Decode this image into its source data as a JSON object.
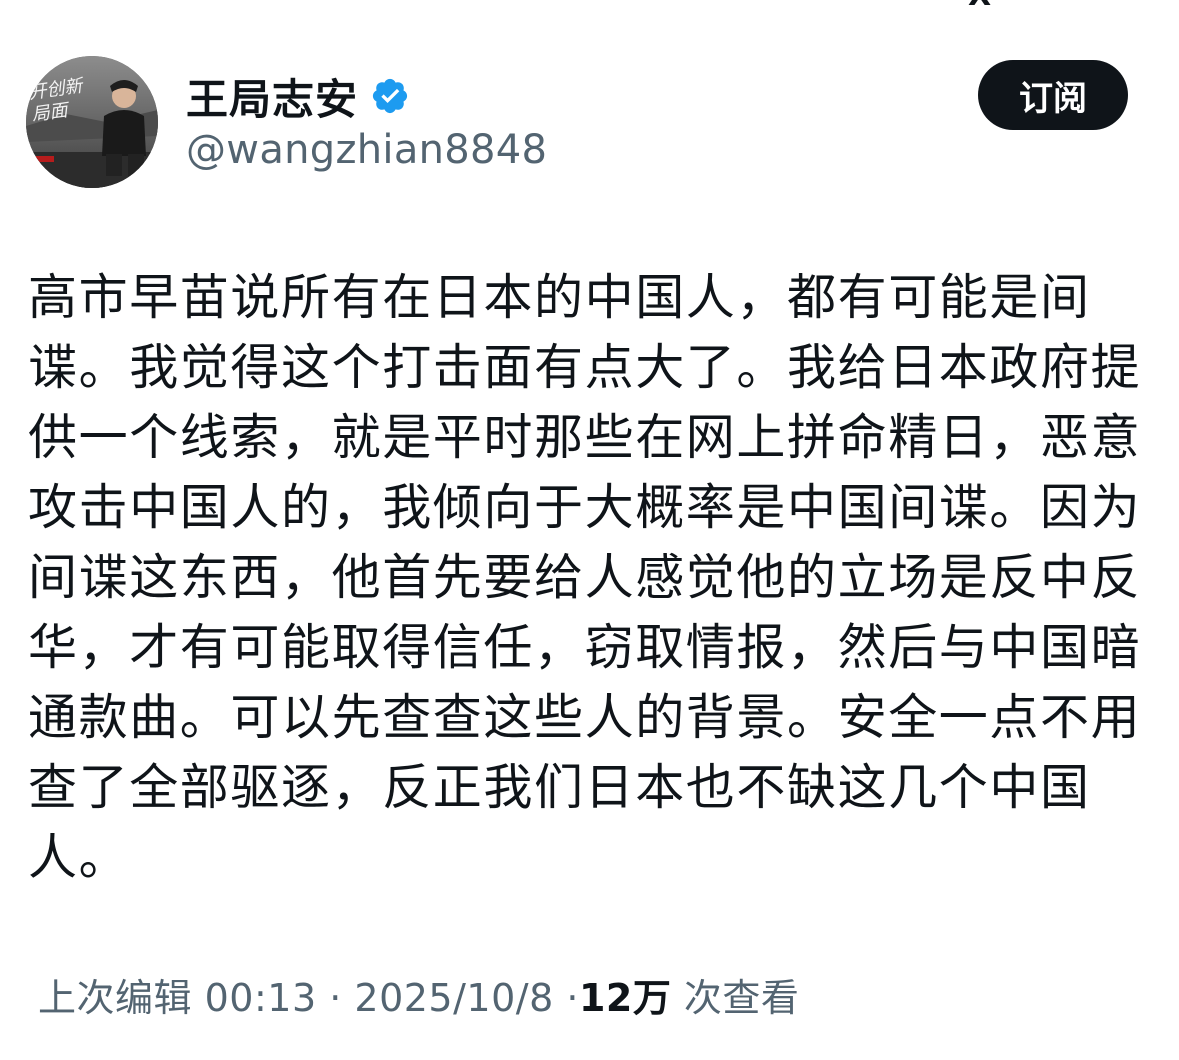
{
  "header": {
    "display_name": "王局志安",
    "handle": "@wangzhian8848",
    "subscribe_label": "订阅",
    "avatar_caption": "开创新局面",
    "logo_text": "X"
  },
  "tweet": {
    "lines": [
      "高市早苗说所有在日本的中国人，都有可能是间",
      "谍。我觉得这个打击面有点大了。我给日本政府提",
      "供一个线索，就是平时那些在网上拼命精日，恶意",
      "攻击中国人的，我倾向于大概率是中国间谍。因为",
      "间谍这东西，他首先要给人感觉他的立场是反中反",
      "华，才有可能取得信任，窃取情报，然后与中国暗",
      "通款曲。可以先查查这些人的背景。安全一点不用",
      "查了全部驱逐，反正我们日本也不缺这几个中国",
      "人。"
    ]
  },
  "meta": {
    "edited_label": "上次编辑",
    "time": "00:13",
    "separator": "·",
    "date": "2025/10/8",
    "views": "12万",
    "views_label": "次查看"
  },
  "colors": {
    "verified_blue": "#1d9bf0",
    "text_primary": "#0f1419",
    "text_secondary": "#536471",
    "button_bg": "#0f1419"
  }
}
